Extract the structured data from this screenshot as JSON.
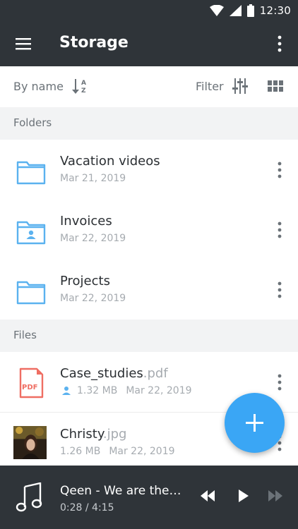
{
  "status": {
    "time": "12:30"
  },
  "appbar": {
    "title": "Storage"
  },
  "toolbar": {
    "sort_label": "By name",
    "filter_label": "Filter"
  },
  "sections": {
    "folders": "Folders",
    "files": "Files"
  },
  "folders": [
    {
      "name": "Vacation videos",
      "date": "Mar 21, 2019",
      "icon": "folder-icon"
    },
    {
      "name": "Invoices",
      "date": "Mar 22, 2019",
      "icon": "shared-folder-icon"
    },
    {
      "name": "Projects",
      "date": "Mar 22, 2019",
      "icon": "folder-icon"
    }
  ],
  "files": [
    {
      "base": "Case_studies",
      "ext": ".pdf",
      "size": "1.32 MB",
      "date": "Mar 22, 2019",
      "shared": true,
      "thumb": "pdf-icon",
      "thumb_label": "PDF"
    },
    {
      "base": "Christy",
      "ext": ".jpg",
      "size": "1.26 MB",
      "date": "Mar 22, 2019",
      "shared": false,
      "thumb": "image-thumbnail"
    }
  ],
  "player": {
    "track": "Qeen - We are the…",
    "time": "0:28 / 4:15"
  },
  "colors": {
    "dark": "#2f3439",
    "accent": "#3aa6f5",
    "folder": "#5bb2ef",
    "pdf": "#ef6e63"
  }
}
